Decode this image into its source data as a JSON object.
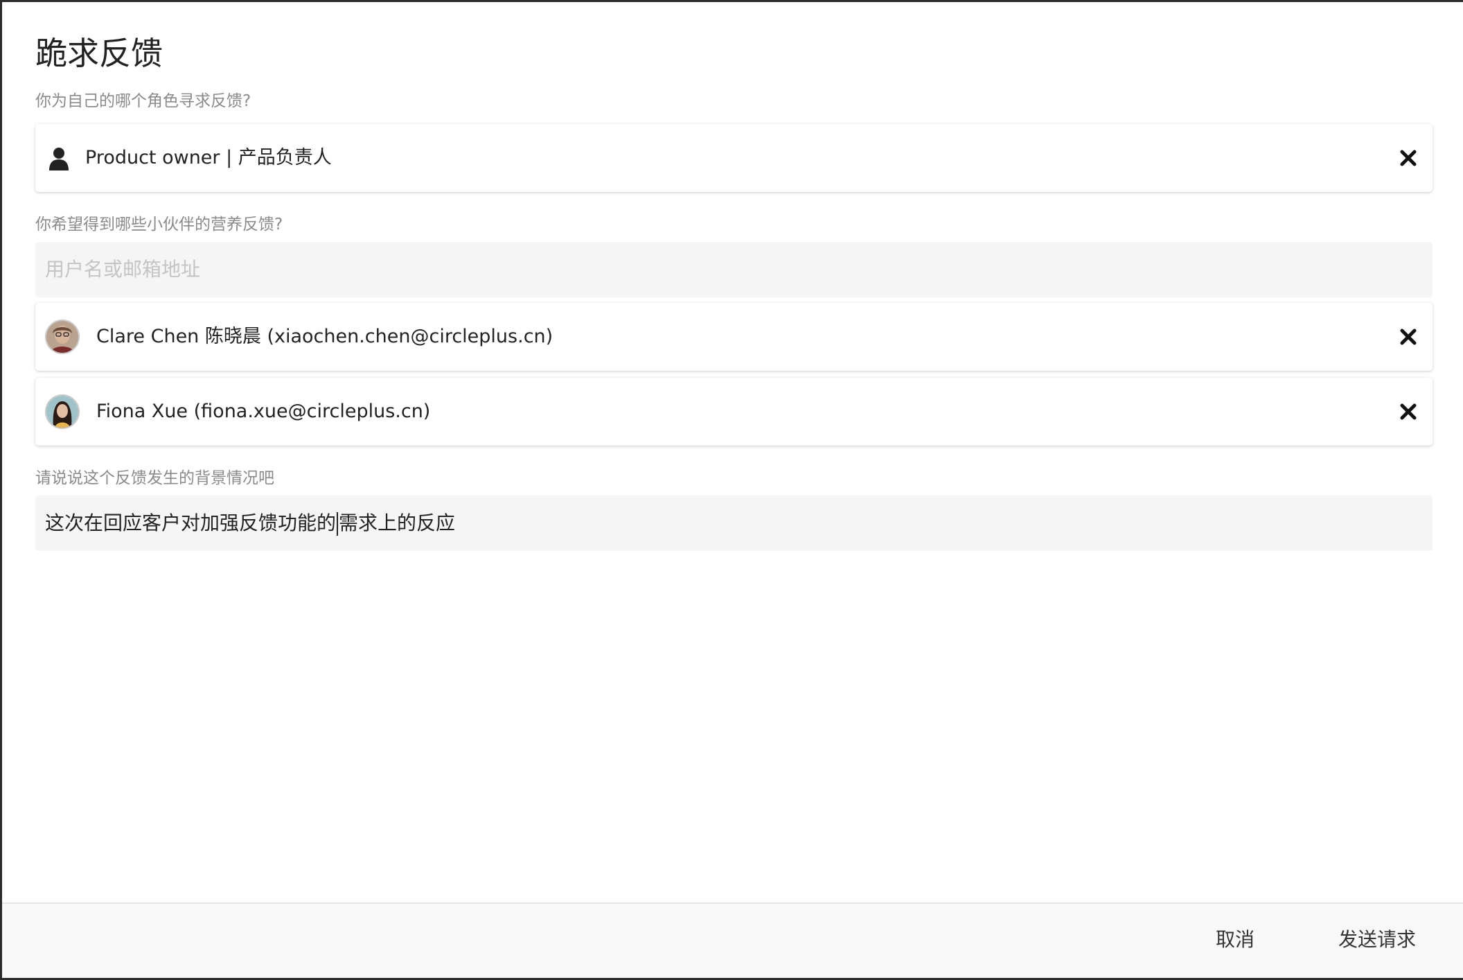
{
  "dialog": {
    "title": "跪求反馈"
  },
  "role_section": {
    "label": "你为自己的哪个角色寻求反馈?",
    "selected_role": "Product owner | 产品负责人",
    "icon": "user-icon"
  },
  "peers_section": {
    "label": "你希望得到哪些小伙伴的营养反馈?",
    "search_placeholder": "用户名或邮箱地址",
    "selected": [
      {
        "display": "Clare Chen 陈晓晨 (xiaochen.chen@circleplus.cn)"
      },
      {
        "display": "Fiona Xue (fiona.xue@circleplus.cn)"
      }
    ]
  },
  "context_section": {
    "label": "请说说这个反馈发生的背景情况吧",
    "value_before_caret": "这次在回应客户对加强反馈功能的",
    "value_after_caret": "需求上的反应"
  },
  "footer": {
    "cancel_label": "取消",
    "send_label": "发送请求"
  },
  "colors": {
    "label_gray": "#8a8a8a",
    "input_bg": "#f5f5f5",
    "footer_bg": "#f8f8f8"
  }
}
